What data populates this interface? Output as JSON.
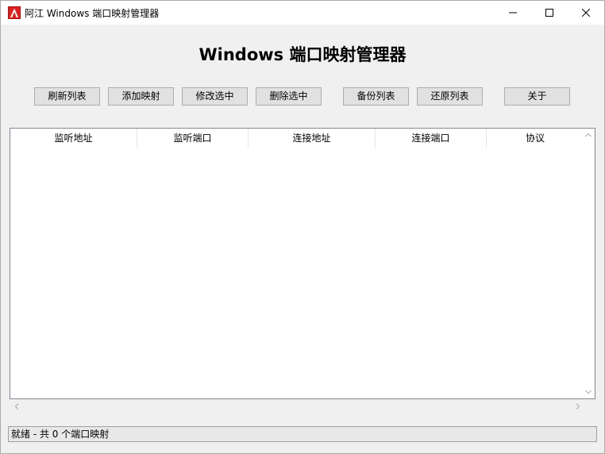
{
  "window": {
    "title": "阿江 Windows 端口映射管理器"
  },
  "header": {
    "title": "Windows 端口映射管理器"
  },
  "toolbar": {
    "refresh": "刷新列表",
    "add": "添加映射",
    "edit": "修改选中",
    "delete": "删除选中",
    "backup": "备份列表",
    "restore": "还原列表",
    "about": "关于"
  },
  "table": {
    "columns": [
      "监听地址",
      "监听端口",
      "连接地址",
      "连接端口",
      "协议"
    ],
    "rows": []
  },
  "status": {
    "text": "就绪 - 共 0 个端口映射"
  },
  "icons": {
    "app": "app-logo-icon",
    "minimize": "minimize-icon",
    "maximize": "maximize-icon",
    "close": "close-icon"
  },
  "colors": {
    "app_icon": "#e01f1f"
  }
}
